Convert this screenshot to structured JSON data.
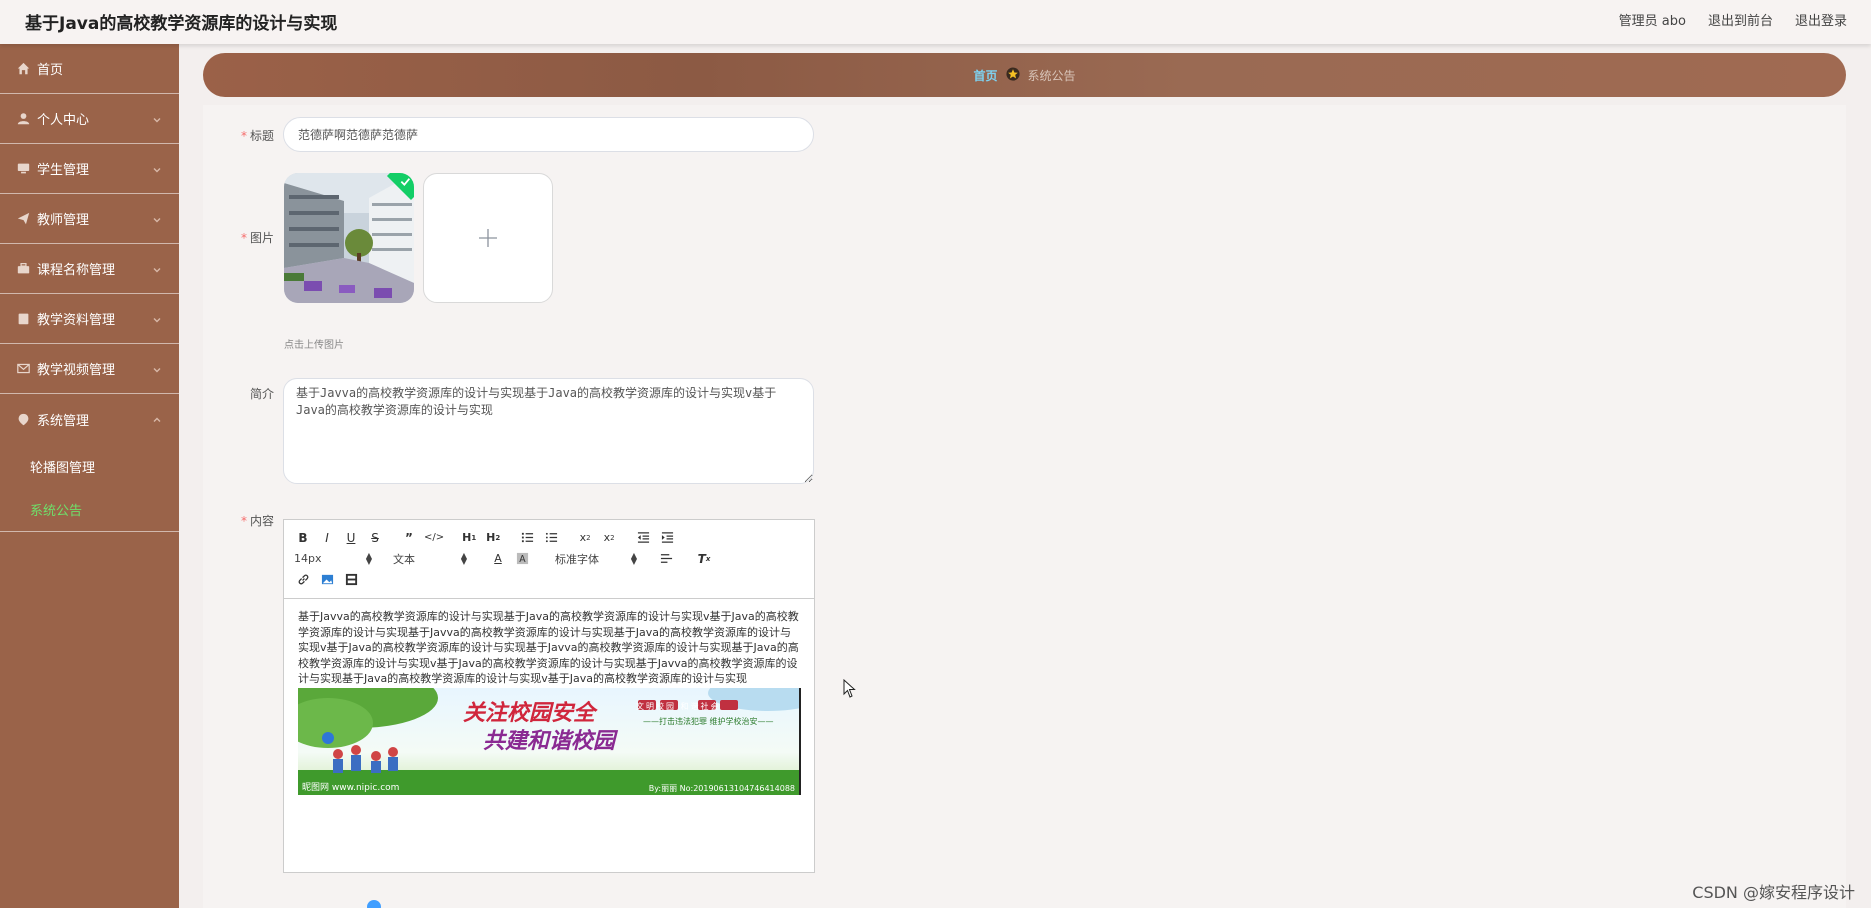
{
  "header": {
    "title": "基于Java的高校教学资源库的设计与实现",
    "user": "管理员 abo",
    "back_to_front": "退出到前台",
    "logout": "退出登录"
  },
  "sidebar": {
    "items": [
      {
        "label": "首页",
        "icon": "home-icon"
      },
      {
        "label": "个人中心",
        "icon": "user-icon"
      },
      {
        "label": "学生管理",
        "icon": "monitor-icon"
      },
      {
        "label": "教师管理",
        "icon": "send-icon"
      },
      {
        "label": "课程名称管理",
        "icon": "briefcase-icon"
      },
      {
        "label": "教学资料管理",
        "icon": "clipboard-icon"
      },
      {
        "label": "教学视频管理",
        "icon": "mail-icon"
      },
      {
        "label": "系统管理",
        "icon": "location-icon"
      }
    ],
    "sub_items": [
      {
        "label": "轮播图管理"
      },
      {
        "label": "系统公告"
      }
    ]
  },
  "breadcrumb": {
    "home": "首页",
    "current": "系统公告"
  },
  "form": {
    "title_label": "标题",
    "title_value": "范德萨啊范德萨范德萨",
    "image_label": "图片",
    "upload_tip": "点击上传图片",
    "intro_label": "简介",
    "intro_value": "基于Javva的高校教学资源库的设计与实现基于Java的高校教学资源库的设计与实现v基于Java的高校教学资源库的设计与实现",
    "content_label": "内容",
    "required_mark": "*"
  },
  "editor": {
    "font_size": "14px",
    "block_type": "文本",
    "font_family": "标准字体",
    "body_text": "基于Javva的高校教学资源库的设计与实现基于Java的高校教学资源库的设计与实现v基于Java的高校教学资源库的设计与实现基于Javva的高校教学资源库的设计与实现基于Java的高校教学资源库的设计与实现v基于Java的高校教学资源库的设计与实现基于Javva的高校教学资源库的设计与实现基于Java的高校教学资源库的设计与实现v基于Java的高校教学资源库的设计与实现基于Javva的高校教学资源库的设计与实现基于Java的高校教学资源库的设计与实现v基于Java的高校教学资源库的设计与实现",
    "banner": {
      "headline_1": "关注校园安全",
      "headline_2": "共建和谐校园",
      "tag_1": "文明校园 和谐社会",
      "tag_2": "——打击违法犯罪 维护学校治安——",
      "footer_left": "昵图网 www.nipic.com",
      "footer_right": "By:丽丽 No:20190613104746414088"
    }
  },
  "watermark": "CSDN @嫁安程序设计",
  "colors": {
    "sidebar": "#9a6349",
    "active_sub": "#6fe06a",
    "crumb_home": "#7fd2f0",
    "required": "#f56c6c"
  }
}
